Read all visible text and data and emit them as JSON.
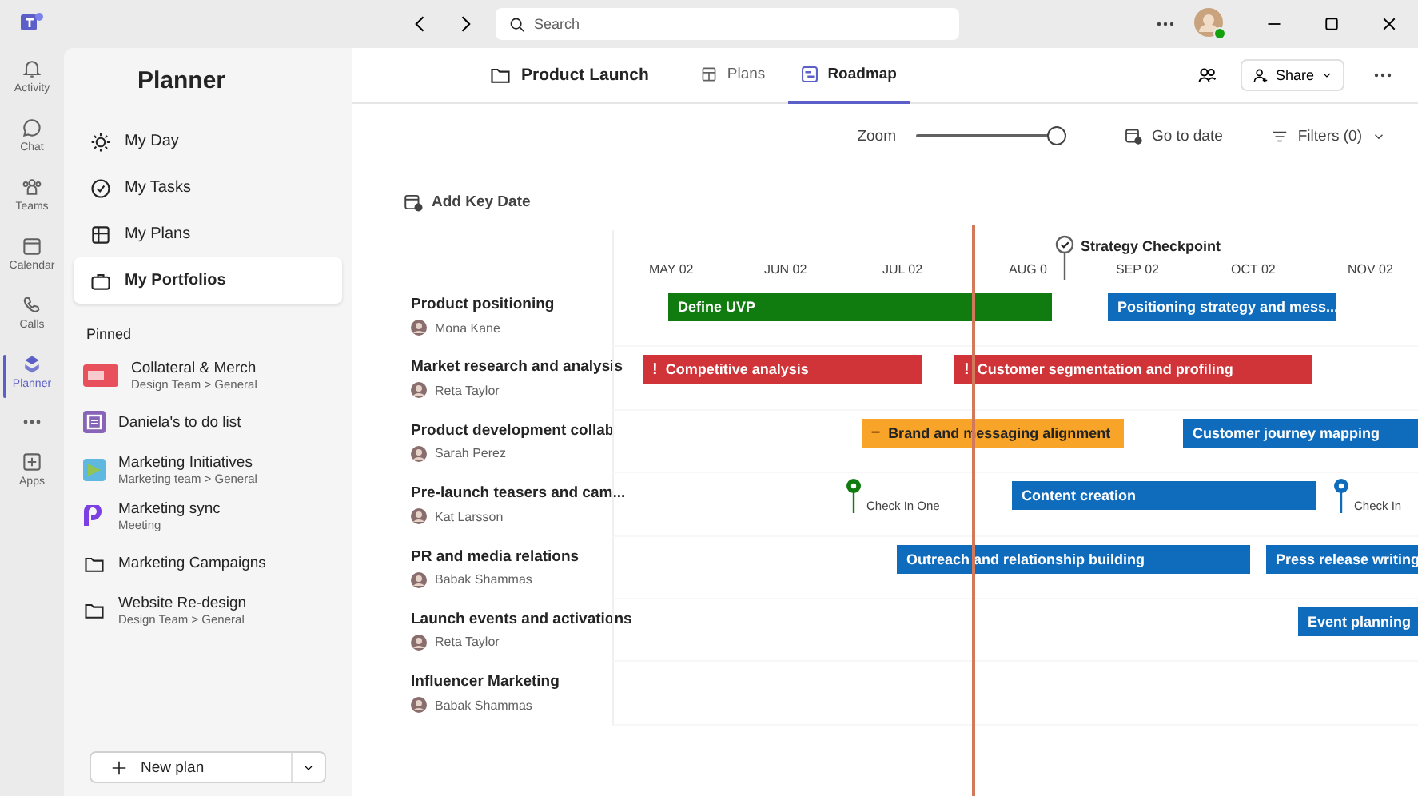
{
  "rail": [
    {
      "label": "Activity",
      "kind": "bell",
      "selected": false
    },
    {
      "label": "Chat",
      "kind": "chat",
      "selected": false
    },
    {
      "label": "Teams",
      "kind": "teams",
      "selected": false
    },
    {
      "label": "Calendar",
      "kind": "calendar",
      "selected": false
    },
    {
      "label": "Calls",
      "kind": "phone",
      "selected": false
    },
    {
      "label": "Planner",
      "kind": "planner",
      "selected": true
    },
    {
      "label": "Apps",
      "kind": "apps",
      "selected": false
    }
  ],
  "titlebar": {
    "search": {
      "placeholder": "Search"
    }
  },
  "sidebar": {
    "title": "Planner",
    "nav": [
      {
        "label": "My Day",
        "kind": "sun",
        "selected": false
      },
      {
        "label": "My Tasks",
        "kind": "tasks",
        "selected": false
      },
      {
        "label": "My Plans",
        "kind": "plans",
        "selected": false
      },
      {
        "label": "My Portfolios",
        "kind": "portfolio",
        "selected": true
      }
    ],
    "pinned_heading": "Pinned",
    "pinned": [
      {
        "title": "Collateral & Merch",
        "subtitle": "Design Team > General",
        "kind": "image"
      },
      {
        "title": "Daniela's to do list",
        "kind": "todo"
      },
      {
        "title": "Marketing Initiatives",
        "subtitle": "Marketing team > General",
        "kind": "plan"
      },
      {
        "title": "Marketing sync",
        "subtitle": "Meeting",
        "kind": "loop"
      },
      {
        "title": "Marketing Campaigns",
        "kind": "folder"
      },
      {
        "title": "Website Re-design",
        "subtitle": "Design Team > General",
        "kind": "folder"
      }
    ],
    "new_plan": "New plan"
  },
  "header": {
    "breadcrumb": "Product Launch",
    "tabs": [
      {
        "label": "Plans",
        "kind": "board",
        "selected": false
      },
      {
        "label": "Roadmap",
        "kind": "roadmap",
        "selected": true
      }
    ],
    "share": "Share"
  },
  "toolbar": {
    "zoom": {
      "label": "Zoom",
      "level": 1
    },
    "go_to_date": "Go to date",
    "filters": "Filters (0)"
  },
  "add_key_date": "Add Key Date",
  "key_dates": [
    {
      "label": "Strategy Checkpoint"
    }
  ],
  "months": [
    "MAY 02",
    "JUN 02",
    "JUL 02",
    "AUG 0",
    "SEP 02",
    "OCT 02",
    "NOV 02"
  ],
  "rows": [
    {
      "title": "Product positioning",
      "owner": "Mona Kane",
      "items": [
        {
          "kind": "bar",
          "label": "Define UVP",
          "color": "#107c10"
        },
        {
          "kind": "bar",
          "label": "Positioning strategy and mess...",
          "color": "#0f6cbd"
        }
      ]
    },
    {
      "title": "Market research and analysis",
      "owner": "Reta Taylor",
      "items": [
        {
          "kind": "bar",
          "label": "Competitive analysis",
          "color": "#d13438",
          "mark": "!"
        },
        {
          "kind": "bar",
          "label": "Customer segmentation and profiling",
          "color": "#d13438",
          "mark": "!"
        }
      ]
    },
    {
      "title": "Product development collab",
      "owner": "Sarah Perez",
      "items": [
        {
          "kind": "bar",
          "label": "Brand and messaging alignment",
          "color": "#f7a428",
          "mark": "–"
        },
        {
          "kind": "bar",
          "label": "Customer journey mapping",
          "color": "#0f6cbd"
        }
      ]
    },
    {
      "title": "Pre-launch teasers and cam...",
      "owner": "Kat Larsson",
      "items": [
        {
          "kind": "milestone",
          "label": "Check In One",
          "color": "#107c10"
        },
        {
          "kind": "bar",
          "label": "Content creation",
          "color": "#0f6cbd"
        },
        {
          "kind": "milestone",
          "label": "Check In",
          "color": "#0f6cbd"
        }
      ]
    },
    {
      "title": "PR and media relations",
      "owner": "Babak Shammas",
      "items": [
        {
          "kind": "bar",
          "label": "Outreach and relationship building",
          "color": "#0f6cbd"
        },
        {
          "kind": "bar",
          "label": "Press release writing",
          "color": "#0f6cbd"
        }
      ]
    },
    {
      "title": "Launch events and activations",
      "owner": "Reta Taylor",
      "items": [
        {
          "kind": "bar",
          "label": "Event planning",
          "color": "#0f6cbd"
        }
      ]
    },
    {
      "title": "Influencer Marketing",
      "owner": "Babak Shammas",
      "items": []
    }
  ]
}
